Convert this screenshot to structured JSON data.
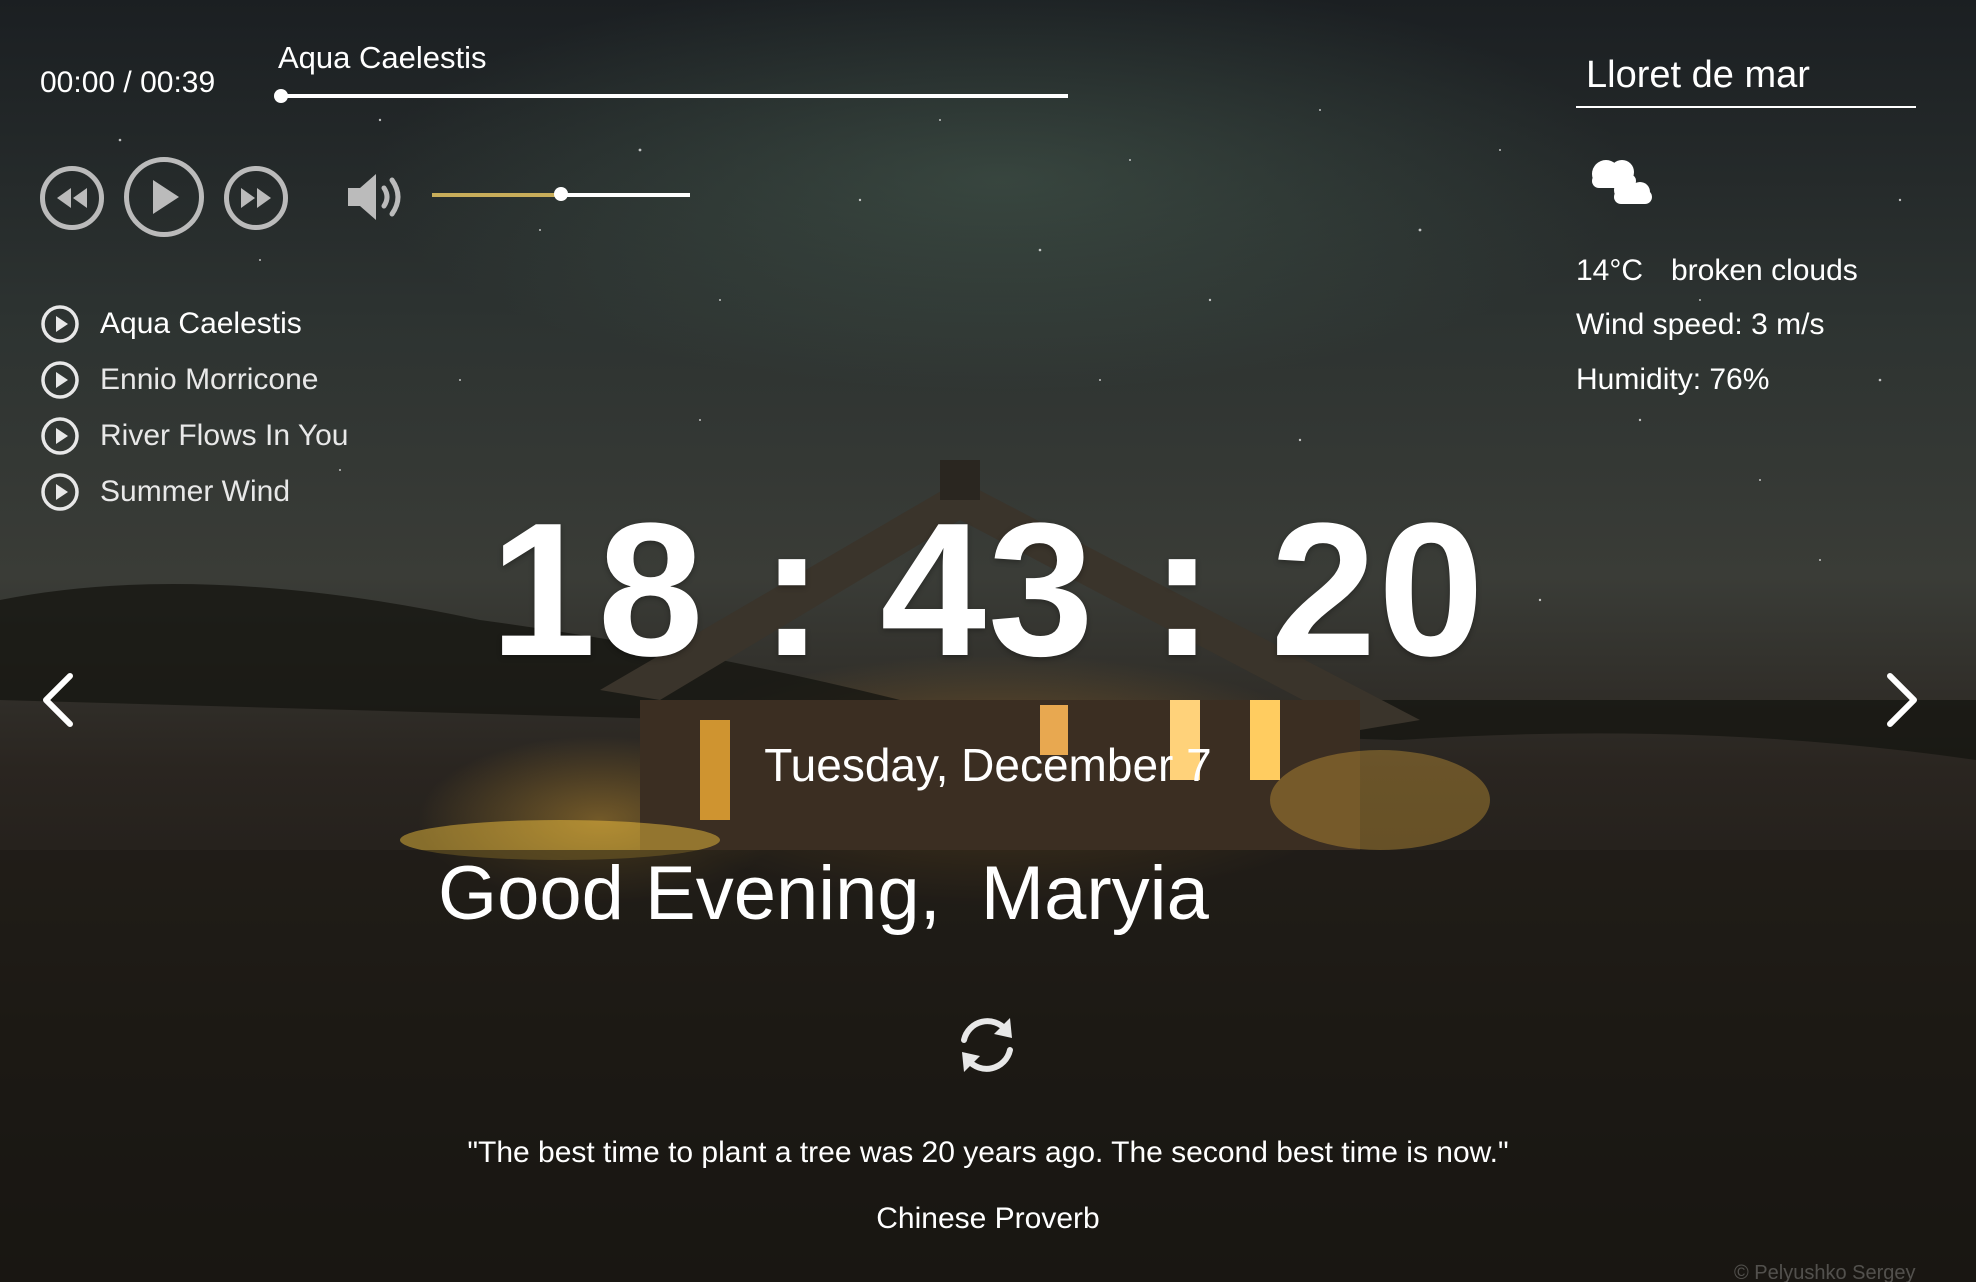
{
  "player": {
    "time": "00:00 / 00:39",
    "current_track": "Aqua Caelestis",
    "progress": 0.0,
    "volume": 0.5,
    "colors": {
      "volume_fill": "#c8ad5a",
      "controls": "#bbbbbb"
    },
    "icons": [
      "play-prev-icon",
      "play-icon",
      "play-next-icon",
      "volume-icon"
    ],
    "playlist": [
      {
        "title": "Aqua Caelestis"
      },
      {
        "title": "Ennio Morricone"
      },
      {
        "title": "River Flows In You"
      },
      {
        "title": "Summer Wind"
      }
    ]
  },
  "weather": {
    "city": "Lloret de mar",
    "icon": "broken-clouds-icon",
    "temperature": "14°C",
    "description": "broken clouds",
    "wind": "Wind speed: 3 m/s",
    "humidity": "Humidity: 76%"
  },
  "clock": {
    "time": "18 : 43 : 20",
    "date": "Tuesday, December 7"
  },
  "greeting": {
    "text": "Good Evening,",
    "name": "Maryia"
  },
  "quote": {
    "text": "\"The best time to plant a tree was 20 years ago. The second best time is now.\"",
    "author": "Chinese Proverb"
  },
  "credit": "© Pelyushko Sergey"
}
